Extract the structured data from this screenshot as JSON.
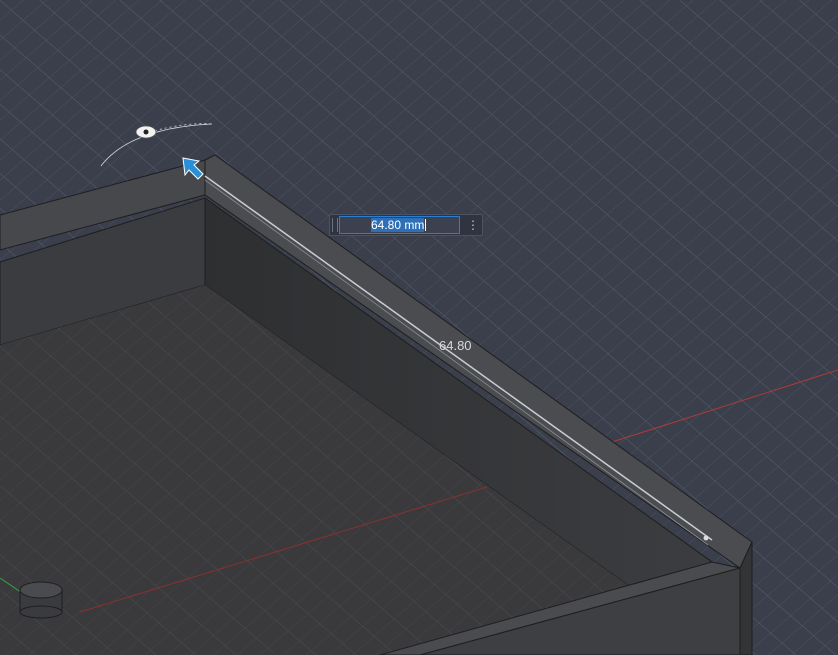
{
  "dimension": {
    "input_value": "64.80 mm",
    "label": "64.80",
    "menu_glyph": "⋮"
  },
  "icons": {
    "move_handle": "arrow-handle-icon",
    "pivot": "pivot-point-icon",
    "menu": "more-options-icon"
  },
  "colors": {
    "background": "#3a3f4b",
    "grid": "#5a6070",
    "x_axis": "#b03a3a",
    "y_axis": "#3aa04a",
    "selection": "#2f6fb5"
  }
}
